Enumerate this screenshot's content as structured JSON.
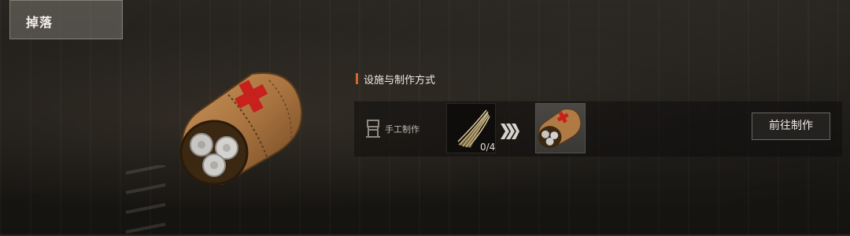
{
  "tab": {
    "label": "掉落"
  },
  "item": {
    "icon": "medkit-roll-icon"
  },
  "section": {
    "title": "设施与制作方式"
  },
  "recipe": {
    "station_icon": "workbench-icon",
    "station_label": "手工制作",
    "ingredient": {
      "icon": "fiber-bundle-icon",
      "count": "0/4"
    },
    "arrow_icon": "chevron-right-triple-icon",
    "result": {
      "icon": "medkit-roll-icon"
    }
  },
  "actions": {
    "go_craft_label": "前往制作"
  },
  "colors": {
    "accent": "#d8662c",
    "panel_bg": "#0e0d0c",
    "cross_red": "#c8201c"
  }
}
